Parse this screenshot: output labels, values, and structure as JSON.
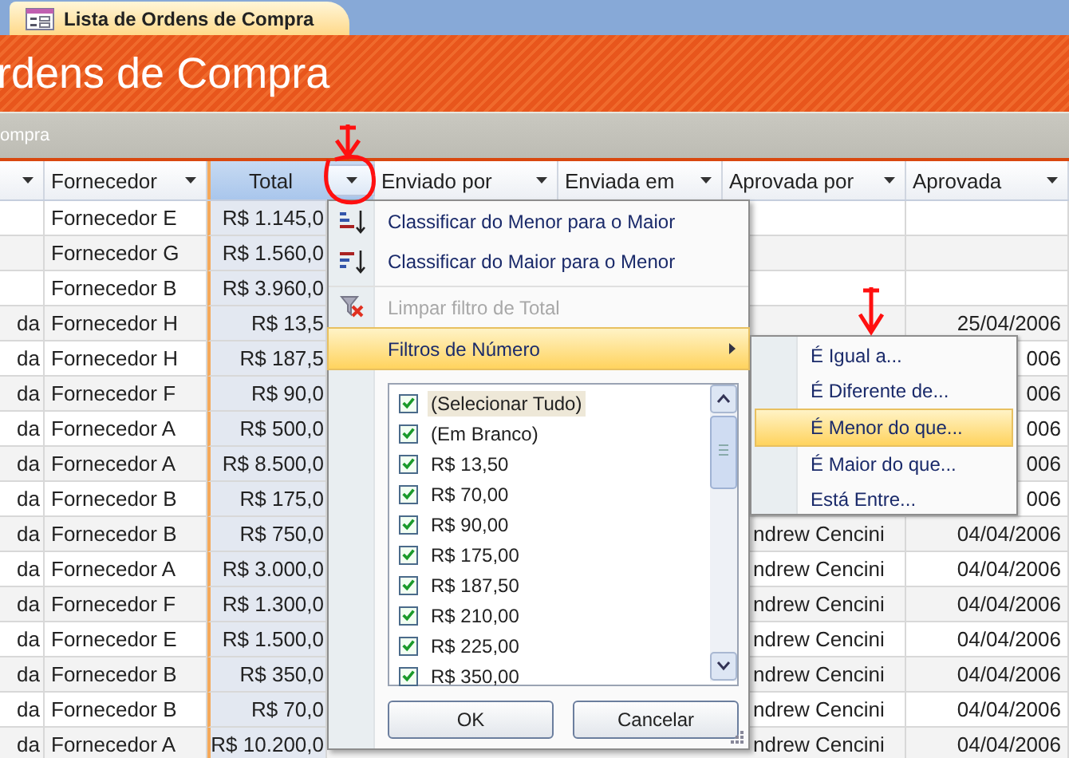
{
  "tab": {
    "label": "Lista de Ordens de Compra",
    "selected": true
  },
  "banner": {
    "title": "rdens de Compra"
  },
  "subbar": {
    "text": "ompra"
  },
  "table": {
    "columns": [
      {
        "selected": false
      },
      {
        "label": "Fornecedor",
        "selected": false
      },
      {
        "label": "Total",
        "selected": true
      },
      {
        "label": "Enviado por",
        "selected": false
      },
      {
        "label": "Enviada em",
        "selected": false
      },
      {
        "label": "Aprovada por",
        "selected": false
      },
      {
        "label": "Aprovada",
        "selected": false
      }
    ],
    "rows": [
      {
        "column_1": "",
        "fornecedor": "Fornecedor E",
        "total": "R$ 1.145,0",
        "aprovada_por": "",
        "aprovada": ""
      },
      {
        "column_1": "",
        "fornecedor": "Fornecedor G",
        "total": "R$ 1.560,0",
        "aprovada_por": "",
        "aprovada": ""
      },
      {
        "column_1": "",
        "fornecedor": "Fornecedor B",
        "total": "R$ 3.960,0",
        "aprovada_por": "",
        "aprovada": ""
      },
      {
        "column_1": "da",
        "fornecedor": "Fornecedor H",
        "total": "R$ 13,5",
        "aprovada_por": "",
        "aprovada": "25/04/2006"
      },
      {
        "column_1": "da",
        "fornecedor": "Fornecedor H",
        "total": "R$ 187,5",
        "aprovada": "006"
      },
      {
        "column_1": "da",
        "fornecedor": "Fornecedor F",
        "total": "R$ 90,0",
        "aprovada": "006"
      },
      {
        "column_1": "da",
        "fornecedor": "Fornecedor A",
        "total": "R$ 500,0",
        "aprovada": "006"
      },
      {
        "column_1": "da",
        "fornecedor": "Fornecedor A",
        "total": "R$ 8.500,0",
        "aprovada": "006"
      },
      {
        "column_1": "da",
        "fornecedor": "Fornecedor B",
        "total": "R$ 175,0",
        "aprovada_por": "",
        "aprovada": "006"
      },
      {
        "column_1": "da",
        "fornecedor": "Fornecedor B",
        "total": "R$ 750,0",
        "aprovada_por": "ndrew Cencini",
        "aprovada": "04/04/2006"
      },
      {
        "column_1": "da",
        "fornecedor": "Fornecedor A",
        "total": "R$ 3.000,0",
        "aprovada_por": "ndrew Cencini",
        "aprovada": "04/04/2006"
      },
      {
        "column_1": "da",
        "fornecedor": "Fornecedor F",
        "total": "R$ 1.300,0",
        "aprovada_por": "ndrew Cencini",
        "aprovada": "04/04/2006"
      },
      {
        "column_1": "da",
        "fornecedor": "Fornecedor E",
        "total": "R$ 1.500,0",
        "aprovada_por": "ndrew Cencini",
        "aprovada": "04/04/2006"
      },
      {
        "column_1": "da",
        "fornecedor": "Fornecedor B",
        "total": "R$ 350,0",
        "aprovada_por": "ndrew Cencini",
        "aprovada": "04/04/2006"
      },
      {
        "column_1": "da",
        "fornecedor": "Fornecedor B",
        "total": "R$ 70,0",
        "aprovada_por": "ndrew Cencini",
        "aprovada": "04/04/2006"
      },
      {
        "column_1": "da",
        "fornecedor": "Fornecedor A",
        "total": "R$ 10.200,0",
        "aprovada_por": "ndrew Cencini",
        "aprovada": "04/04/2006"
      }
    ]
  },
  "filter_menu": {
    "items": [
      {
        "kind": "sort_asc",
        "label": "Classificar do Menor para o Maior",
        "disabled": false,
        "selected": false
      },
      {
        "kind": "sort_desc",
        "label": "Classificar do Maior para o Menor",
        "disabled": false,
        "selected": false
      },
      {
        "kind": "clear_filter",
        "label": "Limpar filtro de Total",
        "disabled": true,
        "selected": false
      },
      {
        "kind": "submenu",
        "label": "Filtros de Número",
        "disabled": false,
        "selected": true
      }
    ],
    "checklist": [
      {
        "label": "(Selecionar Tudo)",
        "checked": true,
        "selected": true
      },
      {
        "label": "(Em Branco)",
        "checked": true,
        "selected": false
      },
      {
        "label": "R$ 13,50",
        "checked": true,
        "selected": false
      },
      {
        "label": "R$ 70,00",
        "checked": true,
        "selected": false
      },
      {
        "label": "R$ 90,00",
        "checked": true,
        "selected": false
      },
      {
        "label": "R$ 175,00",
        "checked": true,
        "selected": false
      },
      {
        "label": "R$ 187,50",
        "checked": true,
        "selected": false
      },
      {
        "label": "R$ 210,00",
        "checked": true,
        "selected": false
      },
      {
        "label": "R$ 225,00",
        "checked": true,
        "selected": false
      },
      {
        "label": "R$ 350,00",
        "checked": true,
        "selected": false
      }
    ],
    "buttons": [
      "OK",
      "Cancelar"
    ]
  },
  "submenu": {
    "items": [
      {
        "label": "É Igual a...",
        "selected": false
      },
      {
        "label": "É Diferente de...",
        "selected": false
      },
      {
        "label": "É Menor do que...",
        "selected": true
      },
      {
        "label": "É Maior do que...",
        "selected": false
      },
      {
        "label": "Está Entre...",
        "selected": false
      }
    ]
  }
}
